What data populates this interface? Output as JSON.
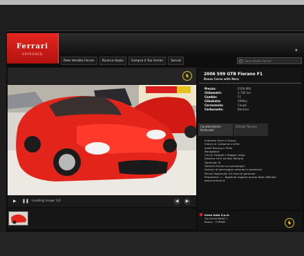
{
  "brand": {
    "name": "Ferrari",
    "subtitle": "APPROVED"
  },
  "menu": {
    "icon": "menu-icon"
  },
  "nav": [
    "Rete Vendita Ferrari",
    "Ricerca Usato",
    "Compra il Tuo Ferrari",
    "Servizi"
  ],
  "search": {
    "placeholder": "Cerca Vostra Ferrari"
  },
  "listing": {
    "title": "2006 599 GTB Fiorano F1",
    "subtitle": "Rosso Corsa with Nero",
    "specs": [
      {
        "label": "Prezzo:",
        "value": "€169.800"
      },
      {
        "label": "Chilometri:",
        "value": "5.700 km"
      },
      {
        "label": "Cambio:",
        "value": "F1"
      },
      {
        "label": "Cilindrata:",
        "value": "5999cc"
      },
      {
        "label": "Carrozzeria:",
        "value": "Coupé"
      },
      {
        "label": "Carburante:",
        "value": "Benzina"
      }
    ],
    "tabs": [
      "Caratteristiche Particolari",
      "Scheda Tecnica"
    ],
    "description": [
      "Impianto Freni in Sasso",
      "Interni in Carbonio e LEDs",
      "Sedili Racing in Pelle",
      "Navigatore",
      "Cerchi Forgiati a Raggio Largo",
      "Sistema Hi-Fi ed Alto Parlanti",
      "Garanzia: Sì",
      "Stemmi Ferrari sui parafanghi",
      "Sensori di parcheggio anteriori e posteriori",
      "Ferrari Approved: 24 mesi di garanzia",
      "Proprietari: 1 - Tagliandi regolari presso Rete Ufficiale",
      "www.irerauto.it"
    ]
  },
  "gallery": {
    "status": "Loading Image 1/1"
  },
  "dealer": {
    "name": "Irene Auto S.p.A.",
    "address": "Via Giulio Natta 1",
    "city": "Reano - TORINO"
  },
  "colors": {
    "accent": "#d81e1e",
    "badge": "#e3c21b",
    "background": "#0e0e0e"
  }
}
